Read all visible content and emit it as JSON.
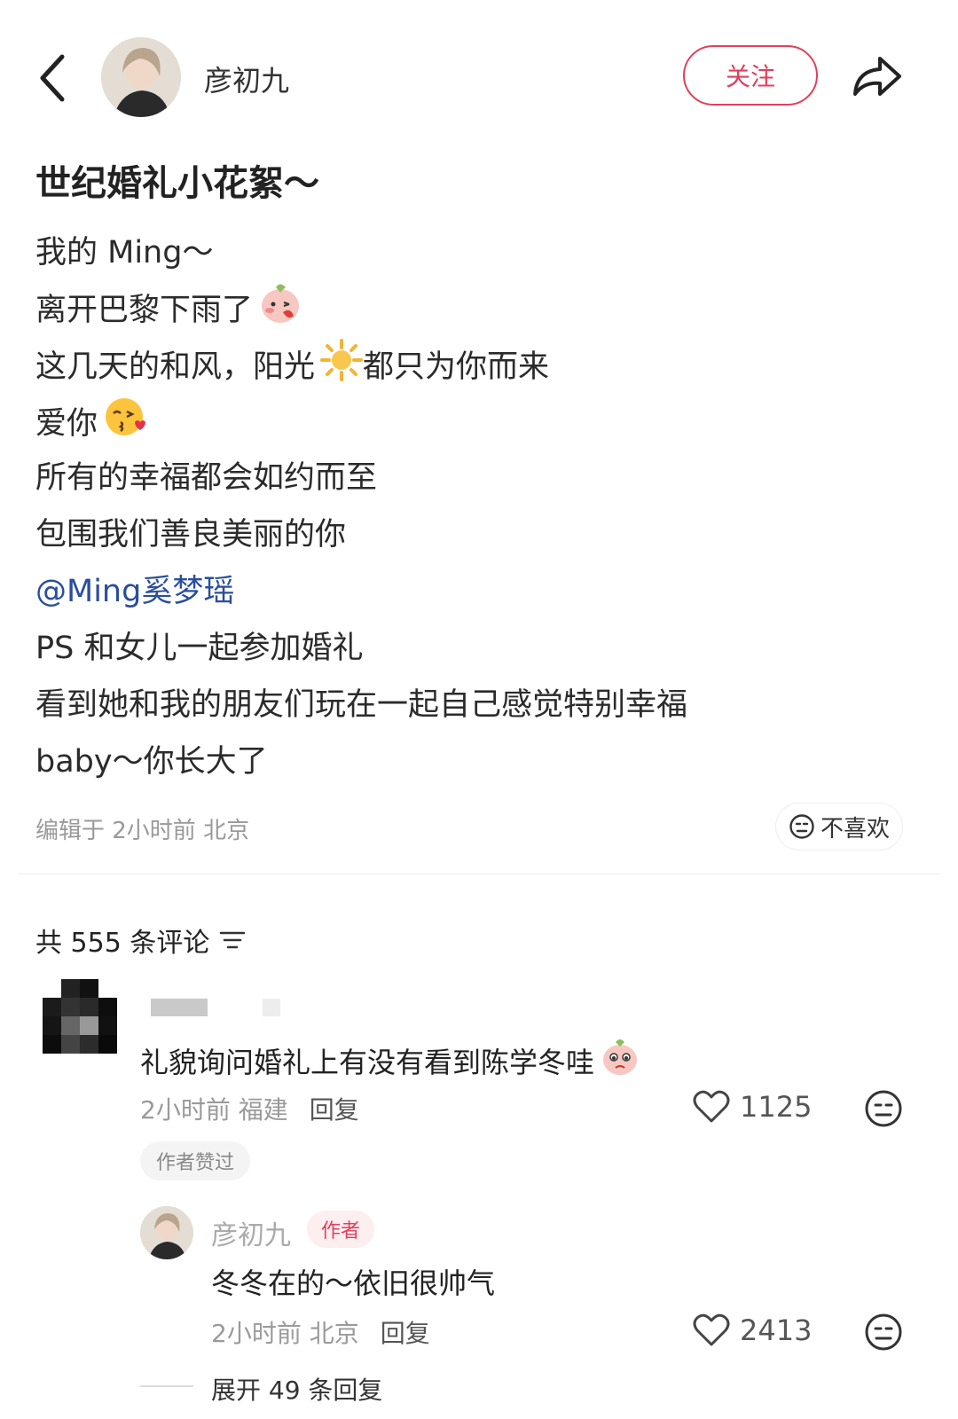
{
  "header": {
    "author_name": "彦初九",
    "follow_label": "关注",
    "icons": [
      "back-chevron-icon",
      "share-arrow-icon"
    ]
  },
  "post": {
    "title": "世纪婚礼小花絮～",
    "lines": [
      "我的 Ming～",
      "离开巴黎下雨了",
      "这几天的和风，阳光",
      "都只为你而来",
      "爱你",
      "所有的幸福都会如约而至",
      "包围我们善良美丽的你",
      "@Ming奚梦瑶",
      "PS 和女儿一起参加婚礼",
      "看到她和我的朋友们玩在一起自己感觉特别幸福",
      "baby～你长大了"
    ],
    "meta": "编辑于 2小时前 北京",
    "dislike_label": "不喜欢"
  },
  "comments": {
    "count_label": "共 555 条评论",
    "first": {
      "text": "礼貌询问婚礼上有没有看到陈学冬哇",
      "time_location": "2小时前 福建",
      "reply_label": "回复",
      "likes": "1125",
      "badge": "作者赞过"
    },
    "reply": {
      "author": "彦初九",
      "tag": "作者",
      "text": "冬冬在的～依旧很帅气",
      "time_location": "2小时前 北京",
      "reply_label": "回复",
      "likes": "2413"
    },
    "expand_label": "展开 49 条回复"
  },
  "colors": {
    "accent": "#e0405c",
    "mention": "#2a4e9c",
    "muted": "#999999"
  }
}
